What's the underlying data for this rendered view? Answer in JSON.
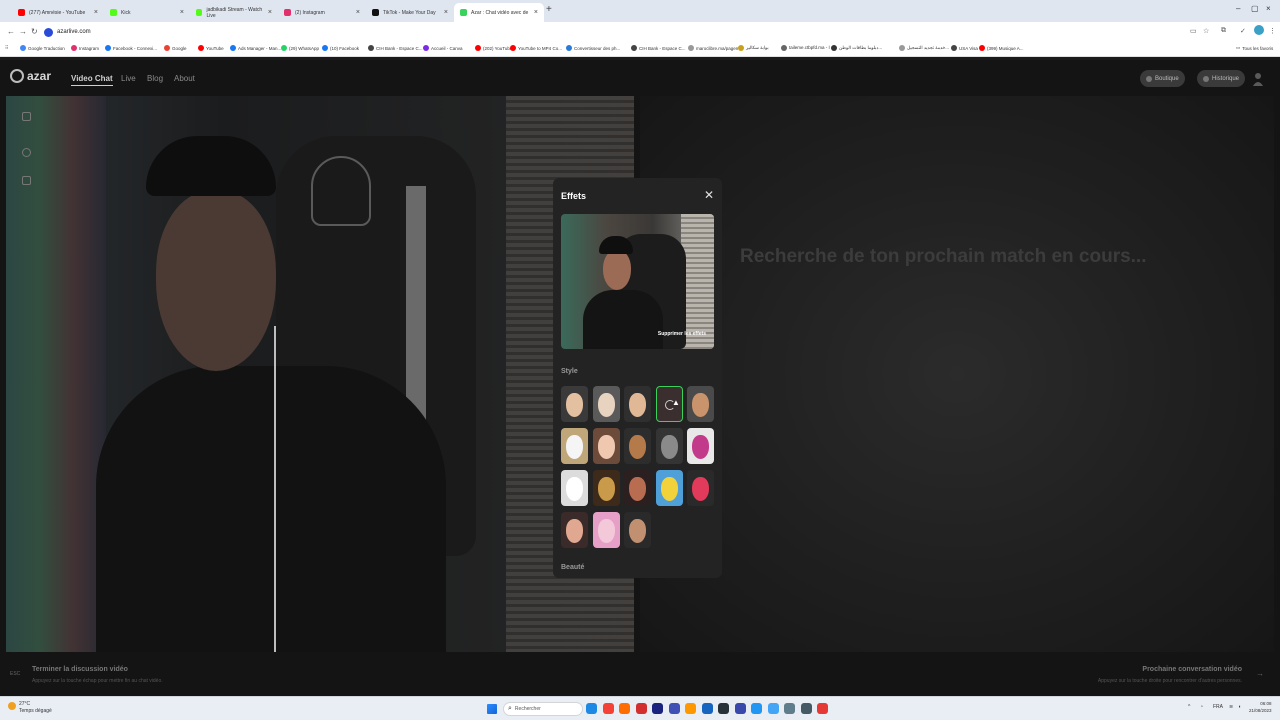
{
  "browser": {
    "tabs": [
      {
        "label": "(277) Amnésie - YouTube",
        "color": "#ff0000"
      },
      {
        "label": "Kick",
        "color": "#53fc18"
      },
      {
        "label": "jadbikadi Stream - Watch Live",
        "color": "#53fc18"
      },
      {
        "label": "(2) Instagram",
        "color": "#e1306c"
      },
      {
        "label": "TikTok - Make Your Day",
        "color": "#111111"
      },
      {
        "label": "Azar : Chat vidéo avec de",
        "color": "#3ad15c"
      }
    ],
    "url": "azarlive.com",
    "bookmarks": [
      {
        "label": "Google Traduction",
        "color": "#4285f4"
      },
      {
        "label": "Instagram",
        "color": "#e1306c"
      },
      {
        "label": "Facebook - Connexi...",
        "color": "#1877f2"
      },
      {
        "label": "Google",
        "color": "#ea4335"
      },
      {
        "label": "YouTube",
        "color": "#ff0000"
      },
      {
        "label": "Ads Manager - Man...",
        "color": "#1877f2"
      },
      {
        "label": "(29) WhatsApp",
        "color": "#25d366"
      },
      {
        "label": "(10) Facebook",
        "color": "#1877f2"
      },
      {
        "label": "CIH Bank - Espace C...",
        "color": "#444444"
      },
      {
        "label": "Accueil - Canva",
        "color": "#7d2ae8"
      },
      {
        "label": "(202) YouTube",
        "color": "#ff0000"
      },
      {
        "label": "YouTube to MP4 Co...",
        "color": "#ff0000"
      },
      {
        "label": "Convertisseur des ph...",
        "color": "#2a7ad7"
      },
      {
        "label": "CIH Bank - Espace C...",
        "color": "#444444"
      },
      {
        "label": "maroclibre.ma/pagem...",
        "color": "#999999"
      },
      {
        "label": "بوابة سكالير",
        "color": "#c8a020"
      },
      {
        "label": "taileme.ctbpfd.ma - ا",
        "color": "#666666"
      },
      {
        "label": "دبلوما بطاقات الوطن...",
        "color": "#333333"
      },
      {
        "label": "خدمة تجديد التسجيل...",
        "color": "#999999"
      },
      {
        "label": "USA Visa",
        "color": "#444444"
      },
      {
        "label": "(399) Musique A...",
        "color": "#ff0000"
      }
    ],
    "all_bookmarks": "Tous les favoris"
  },
  "site": {
    "logo": "azar",
    "nav": [
      "Video Chat",
      "Live",
      "Blog",
      "About"
    ],
    "shop_label": "Boutique",
    "history_label": "Historique"
  },
  "status": {
    "searching": "Recherche de ton prochain match en cours..."
  },
  "footer": {
    "esc_key": "ESC",
    "end_title": "Terminer la discussion vidéo",
    "end_sub": "Appuyez sur la touche échap pour mettre fin au chat vidéo.",
    "next_title": "Prochaine conversation vidéo",
    "next_sub": "Appuyez sur la touche droite pour rencontrer d'autres personnes."
  },
  "effects": {
    "title": "Effets",
    "remove_label": "Supprimer les effets",
    "style_label": "Style",
    "beauty_label": "Beauté",
    "styles": [
      {
        "name": "style-1",
        "bg": "#3a3a3a",
        "face": "#e2c0a0"
      },
      {
        "name": "style-2",
        "bg": "#5a5a5a",
        "face": "#e7d3c0"
      },
      {
        "name": "style-3",
        "bg": "#2f2f2f",
        "face": "#e0b896"
      },
      {
        "name": "style-4",
        "bg": "#3b2e2e",
        "face": "#3b2e2e",
        "selected": true
      },
      {
        "name": "style-5",
        "bg": "#4a4a4a",
        "face": "#c9936c"
      },
      {
        "name": "style-6",
        "bg": "#bfa77a",
        "face": "#f5f5f5"
      },
      {
        "name": "style-7",
        "bg": "#6d4b3a",
        "face": "#f0c8b0"
      },
      {
        "name": "style-8",
        "bg": "#2d2d2d",
        "face": "#b57a4a"
      },
      {
        "name": "style-9",
        "bg": "#343434",
        "face": "#8a8a8a"
      },
      {
        "name": "style-10",
        "bg": "#e8e8e8",
        "face": "#c23a8a"
      },
      {
        "name": "style-11",
        "bg": "#dcdcdc",
        "face": "#ffffff"
      },
      {
        "name": "style-12",
        "bg": "#3e2a1a",
        "face": "#c89a4a"
      },
      {
        "name": "style-13",
        "bg": "#2b1f1f",
        "face": "#b86c50"
      },
      {
        "name": "style-14",
        "bg": "#4fa0d8",
        "face": "#f2d23a"
      },
      {
        "name": "style-15",
        "bg": "#2a2a2a",
        "face": "#e23a5a"
      },
      {
        "name": "style-16",
        "bg": "#3a2a2a",
        "face": "#e0a890"
      },
      {
        "name": "style-17",
        "bg": "#e6a0c8",
        "face": "#f3c8d8"
      },
      {
        "name": "style-18",
        "bg": "#2a2a2a",
        "face": "#c09070"
      }
    ]
  },
  "taskbar": {
    "temperature": "27°C",
    "weather": "Temps dégagé",
    "search": "Rechercher",
    "lang": "FRA",
    "time": "06:08",
    "date": "21/08/2023",
    "apps": [
      "#1e88e5",
      "#f44336",
      "#ff6d00",
      "#d32f2f",
      "#1a237e",
      "#3f51b5",
      "#ff9800",
      "#1565c0",
      "#263238",
      "#3949ab",
      "#2196f3",
      "#42a5f5",
      "#607d8b",
      "#455a64",
      "#e53935"
    ]
  }
}
